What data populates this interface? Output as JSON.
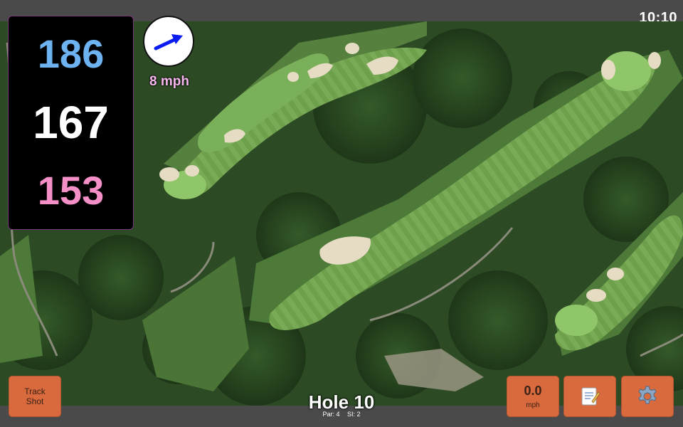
{
  "status": {
    "time": "10:10"
  },
  "distances": {
    "back": "186",
    "middle": "167",
    "front": "153"
  },
  "wind": {
    "speed_text": "8 mph",
    "icon": "wind-arrow-icon"
  },
  "buttons": {
    "track_shot": "Track\nShot",
    "shot_speed_value": "0.0",
    "shot_speed_unit": "mph",
    "notes_icon": "notepad-icon",
    "settings_icon": "gear-icon"
  },
  "hole": {
    "title": "Hole 10",
    "par": "Par: 4",
    "si": "SI: 2"
  },
  "colors": {
    "button": "#d86a3d",
    "back_distance": "#6db3f2",
    "middle_distance": "#ffffff",
    "front_distance": "#f48fc7",
    "wind_text": "#f7b7ee",
    "bar": "#4a4a4a"
  }
}
